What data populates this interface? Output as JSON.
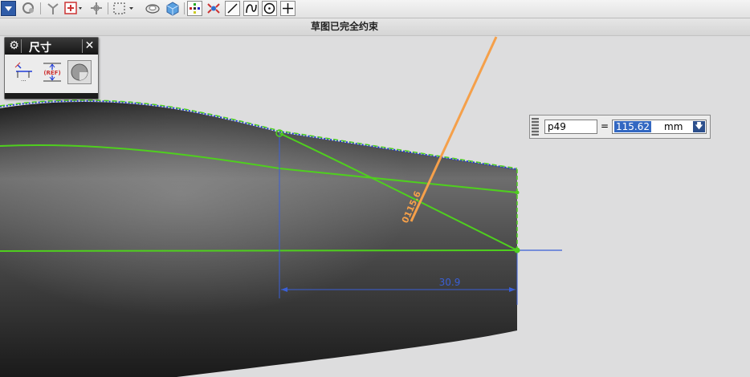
{
  "status": {
    "text": "草图已完全约束"
  },
  "palette": {
    "title": "尺寸",
    "buttons": [
      "rapid-dimension",
      "reference-dimension",
      "continuous-auto-dimension"
    ]
  },
  "expression": {
    "name": "p49",
    "equals": "=",
    "value": "115.62",
    "unit": "mm"
  },
  "sketch": {
    "horizontal_dimension": "30.9",
    "angle_dimension": "0115.6"
  },
  "colors": {
    "sketch_curve": "#4fcf1e",
    "dimension": "#3a5fd6",
    "angle_leader": "#f5a04a",
    "constraint_dots": "#1e3bd8",
    "selection": "#3368c2"
  },
  "icons": {
    "toolbar": [
      "view-dropdown-icon",
      "orient-icon",
      "snap-icon",
      "point-dropdown-icon",
      "move-icon",
      "select-rect-icon",
      "render-icon",
      "cube-icon",
      "constraint-icon",
      "show-constraints-icon",
      "line-icon",
      "arc-icon",
      "circle-icon",
      "plus-icon"
    ]
  }
}
